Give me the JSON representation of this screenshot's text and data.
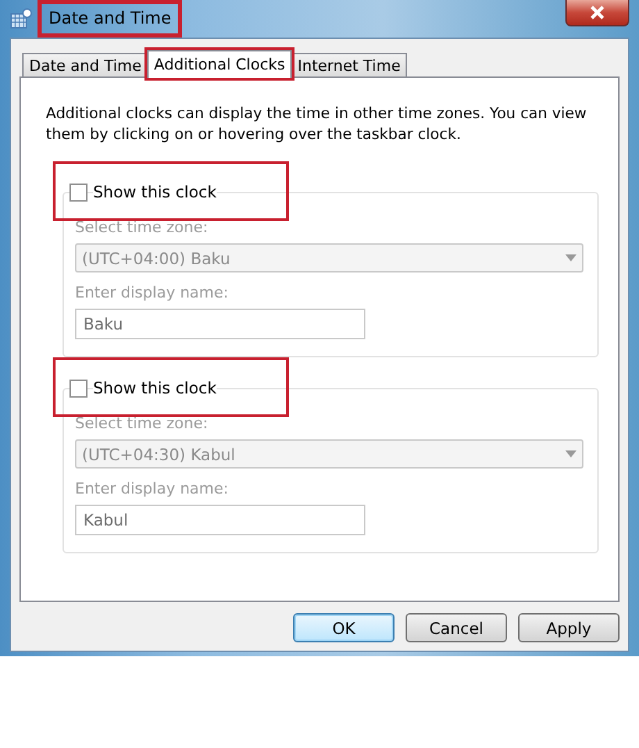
{
  "window": {
    "title": "Date and Time",
    "highlighted": true
  },
  "tabs": [
    {
      "label": "Date and Time",
      "selected": false,
      "highlighted": false
    },
    {
      "label": "Additional Clocks",
      "selected": true,
      "highlighted": true
    },
    {
      "label": "Internet Time",
      "selected": false,
      "highlighted": false
    }
  ],
  "description": "Additional clocks can display the time in other time zones. You can view them by clicking on or hovering over the taskbar clock.",
  "clocks": [
    {
      "checkbox_label": "Show this clock",
      "checked": false,
      "highlighted": true,
      "zone_label": "Select time zone:",
      "zone": "(UTC+04:00) Baku",
      "name_label": "Enter display name:",
      "name": "Baku"
    },
    {
      "checkbox_label": "Show this clock",
      "checked": false,
      "highlighted": true,
      "zone_label": "Select time zone:",
      "zone": "(UTC+04:30) Kabul",
      "name_label": "Enter display name:",
      "name": "Kabul"
    }
  ],
  "buttons": [
    {
      "label": "OK",
      "default": true
    },
    {
      "label": "Cancel",
      "default": false
    },
    {
      "label": "Apply",
      "default": false
    }
  ]
}
